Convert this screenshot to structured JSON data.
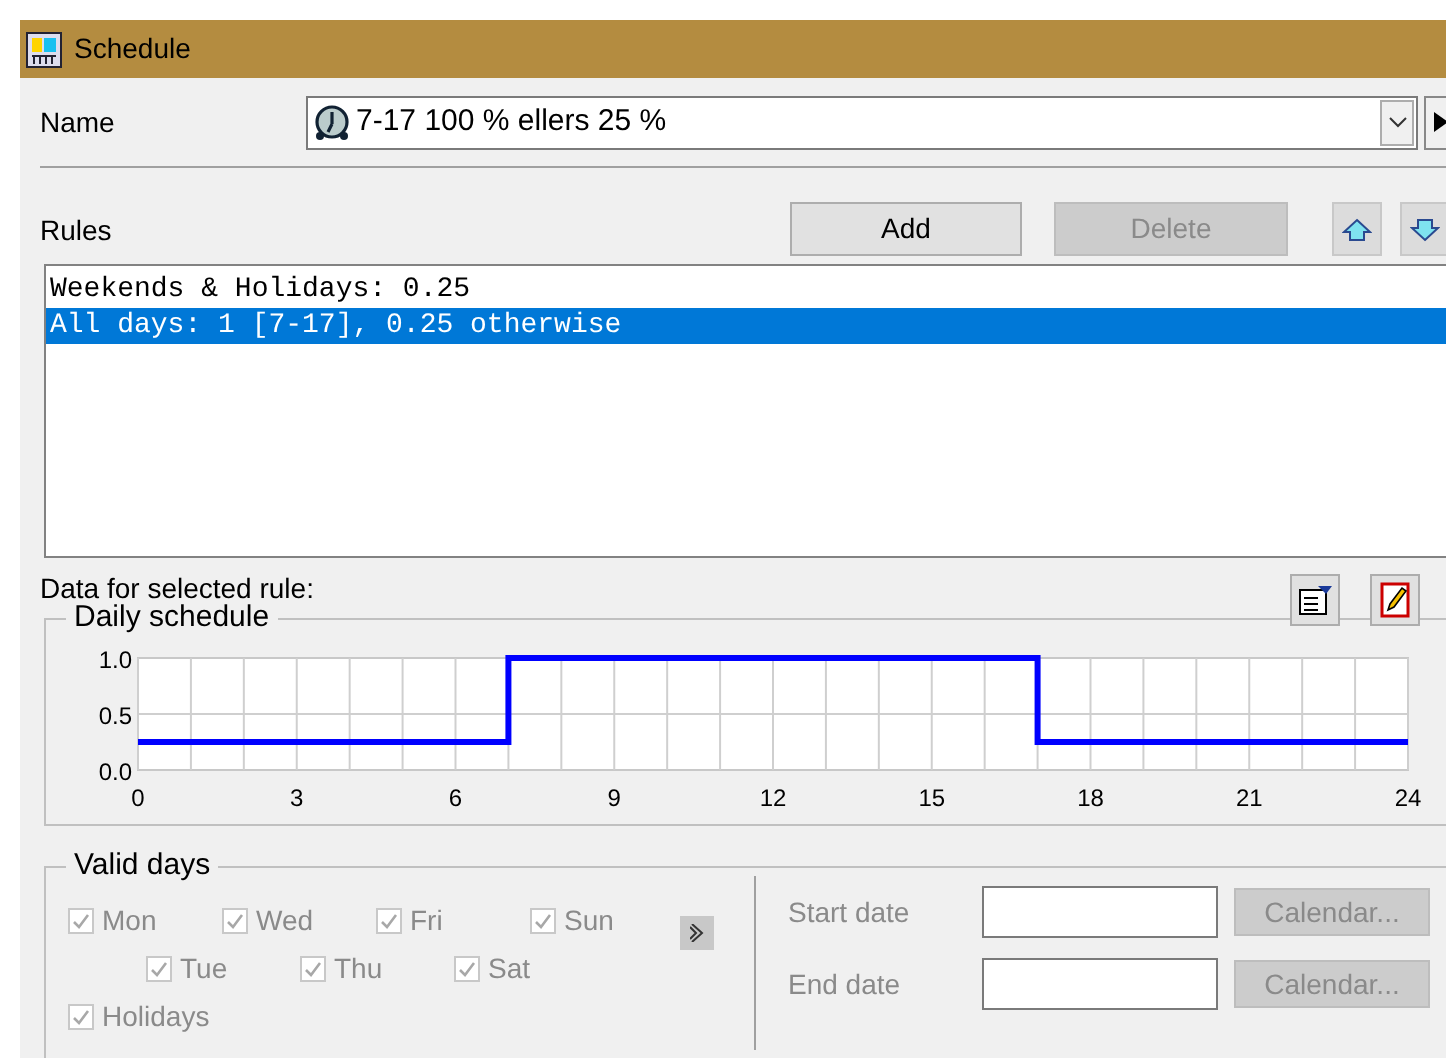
{
  "window": {
    "title": "Schedule"
  },
  "name": {
    "label": "Name",
    "value": "7-17 100 % ellers 25 %"
  },
  "rules": {
    "label": "Rules",
    "buttons": [
      {
        "label": "Add",
        "disabled": false
      },
      {
        "label": "Delete",
        "disabled": true
      }
    ],
    "items": [
      {
        "text": "Weekends & Holidays: 0.25",
        "selected": false
      },
      {
        "text": "All days: 1 [7-17], 0.25 otherwise",
        "selected": true
      }
    ]
  },
  "data_label": "Data for selected rule:",
  "daily_schedule": {
    "title": "Daily schedule",
    "chart_data": {
      "type": "line",
      "x": [
        0,
        7,
        7,
        17,
        17,
        24
      ],
      "series": [
        {
          "color": "#0000ff",
          "values": [
            0.25,
            0.25,
            1,
            1,
            0.25,
            0.25
          ]
        }
      ],
      "grid": true,
      "xlim": [
        0,
        24
      ],
      "ylim": [
        0,
        1
      ],
      "xticks": [
        0,
        3,
        6,
        9,
        12,
        15,
        18,
        21,
        24
      ],
      "yticks": [
        {
          "value": 0,
          "label": "0.0"
        },
        {
          "value": 0.5,
          "label": "0.5"
        },
        {
          "value": 1,
          "label": "1.0"
        }
      ]
    }
  },
  "valid_days": {
    "title": "Valid days",
    "days": [
      {
        "label": "Mon",
        "checked": true,
        "disabled": true
      },
      {
        "label": "Wed",
        "checked": true,
        "disabled": true
      },
      {
        "label": "Fri",
        "checked": true,
        "disabled": true
      },
      {
        "label": "Sun",
        "checked": true,
        "disabled": true
      },
      {
        "label": "Tue",
        "checked": true,
        "disabled": true
      },
      {
        "label": "Thu",
        "checked": true,
        "disabled": true
      },
      {
        "label": "Sat",
        "checked": true,
        "disabled": true
      },
      {
        "label": "Holidays",
        "checked": true,
        "disabled": true
      }
    ],
    "dates": [
      {
        "label": "Start date",
        "button": "Calendar...",
        "disabled": true
      },
      {
        "label": "End date",
        "button": "Calendar...",
        "disabled": true
      }
    ]
  }
}
